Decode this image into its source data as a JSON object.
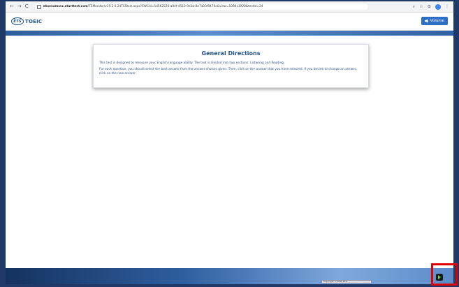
{
  "browser": {
    "nav_back": "←",
    "nav_forward": "→",
    "nav_reload": "C",
    "url_host": "ehsexamsvc.starttest.com",
    "url_path": "/TEMonitor/v19.2.0.2/ITSStart.aspx?SWCid=5d562526-a84f-4510-9e2b-8e7a03f9476c&view=1080x1920&testid=24"
  },
  "header": {
    "ets_badge": "ETS",
    "product": "TOEIC",
    "volume_label": "Volume"
  },
  "card": {
    "title": "General Directions",
    "paragraph1": "This test is designed to measure your English language ability. The test is divided into two sections: Listening and Reading.",
    "paragraph2": "For each question, you should select the best answer from the answer choices given. Then, click on the answer that you have selected. If you decide to change an answer, click on the new answer."
  },
  "footer": {
    "label": "Copyright © 2019 ETS"
  },
  "colors": {
    "brand": "#1d4f91",
    "accent": "#2d6fc4",
    "highlight": "#e00000",
    "next_arrow": "#5fd24a"
  }
}
